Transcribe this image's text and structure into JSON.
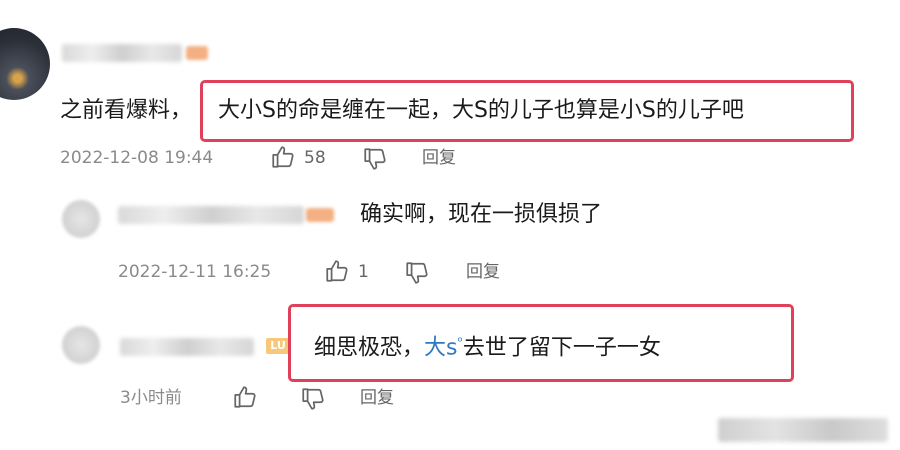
{
  "main_comment": {
    "prefix": "之前看爆料，",
    "highlighted": "大小S的命是缠在一起，大S的儿子也算是小S的儿子吧",
    "timestamp": "2022-12-08 19:44",
    "likes": "58",
    "reply_label": "回复"
  },
  "reply_1": {
    "text": "确实啊，现在一损俱损了",
    "timestamp": "2022-12-11 16:25",
    "likes": "1",
    "reply_label": "回复"
  },
  "reply_2": {
    "badge": "LU",
    "text_before": "细思极恐，",
    "mention": "大s",
    "mention_mark": "ᵒ",
    "text_after": "去世了留下一子一女",
    "timestamp": "3小时前",
    "reply_label": "回复"
  },
  "colors": {
    "highlight_border": "#e0405a",
    "meta_text": "#8a8a8a",
    "mention": "#2f78c4"
  },
  "icons": {
    "like": "thumbs-up-icon",
    "dislike": "thumbs-down-icon"
  }
}
